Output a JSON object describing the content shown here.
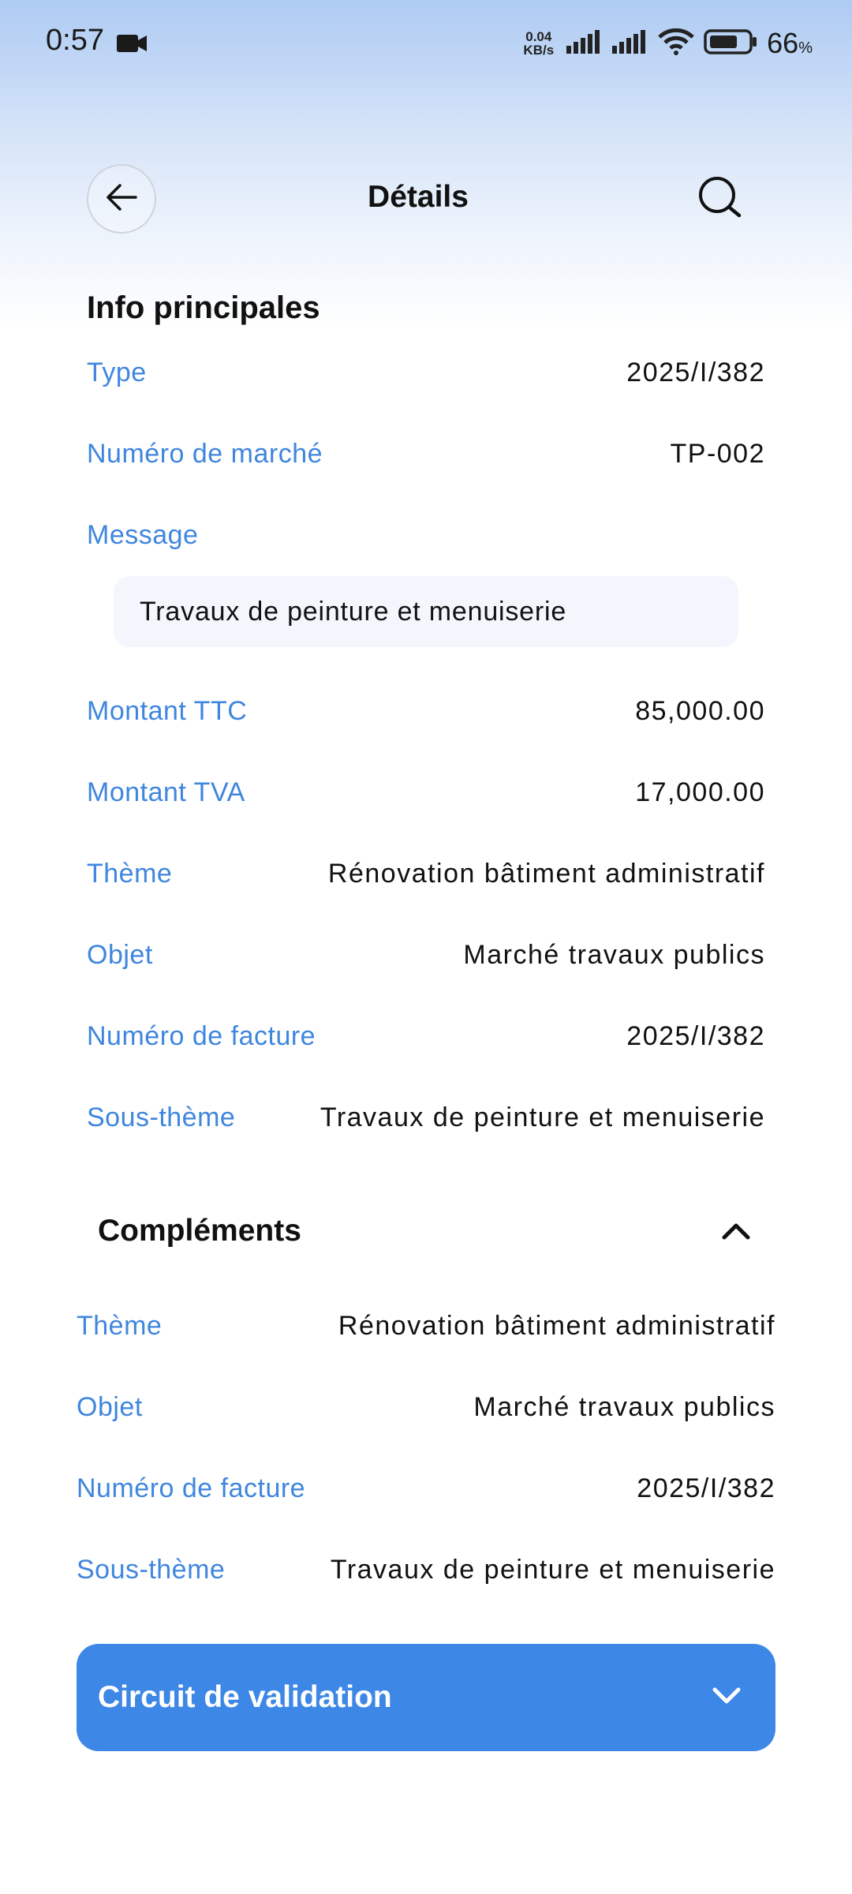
{
  "status_bar": {
    "time": "0:57",
    "net_speed_value": "0.04",
    "net_speed_unit": "KB/s",
    "battery_percent": "66",
    "battery_percent_sign": "%",
    "icons": [
      "video-camera-icon",
      "signal-icon",
      "signal-icon",
      "wifi-icon",
      "battery-icon"
    ]
  },
  "header": {
    "title": "Détails",
    "back_icon": "arrow-left-icon",
    "search_icon": "search-icon"
  },
  "info": {
    "title": "Info principales",
    "rows": [
      {
        "label": "Type",
        "value": "2025/I/382"
      },
      {
        "label": "Numéro de marché",
        "value": "TP-002"
      }
    ],
    "message_label": "Message",
    "message_text": "Travaux de peinture et menuiserie",
    "rows2": [
      {
        "label": "Montant TTC",
        "value": "85,000.00"
      },
      {
        "label": "Montant TVA",
        "value": "17,000.00"
      },
      {
        "label": "Thème",
        "value": "Rénovation bâtiment administratif"
      },
      {
        "label": "Objet",
        "value": "Marché travaux publics"
      },
      {
        "label": "Numéro de facture",
        "value": "2025/I/382"
      },
      {
        "label": "Sous-thème",
        "value": "Travaux de peinture et menuiserie"
      }
    ]
  },
  "complements": {
    "title": "Compléments",
    "expanded": true,
    "rows": [
      {
        "label": "Thème",
        "value": "Rénovation bâtiment administratif"
      },
      {
        "label": "Objet",
        "value": "Marché travaux publics"
      },
      {
        "label": "Numéro de facture",
        "value": "2025/I/382"
      },
      {
        "label": "Sous-thème",
        "value": "Travaux de peinture et menuiserie"
      }
    ]
  },
  "circuit": {
    "label": "Circuit de validation",
    "color": "#3d87e6"
  },
  "colors": {
    "label_blue": "#3f86de",
    "message_bg": "#f3f6fd"
  }
}
